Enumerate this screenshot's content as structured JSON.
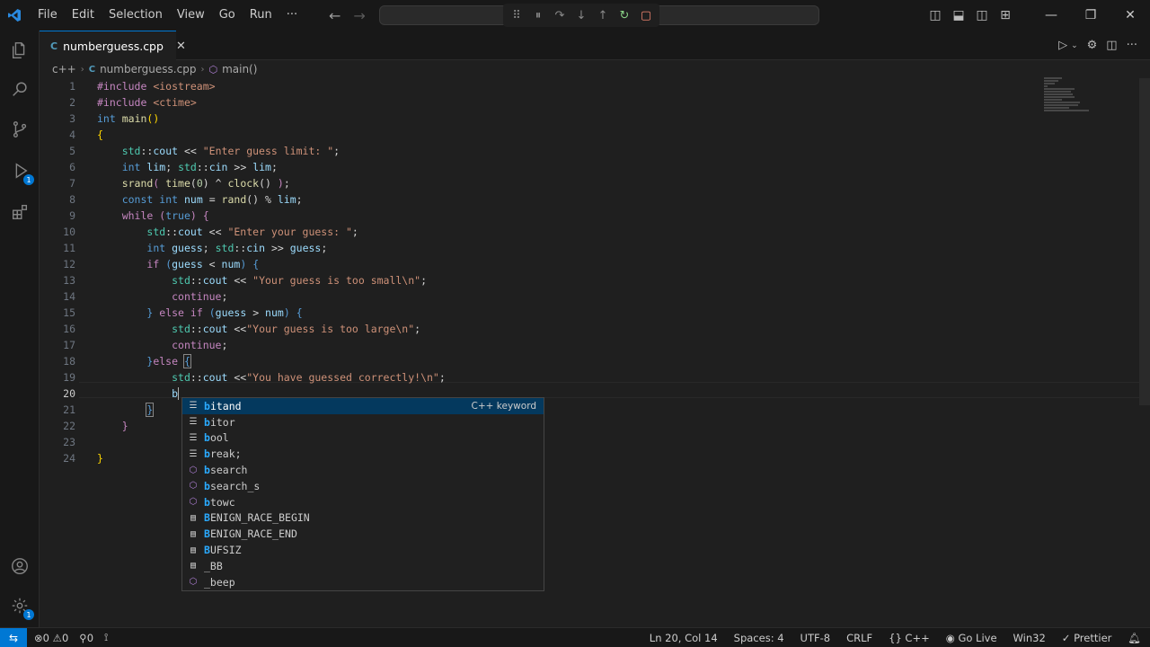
{
  "menu": [
    "File",
    "Edit",
    "Selection",
    "View",
    "Go",
    "Run",
    "···"
  ],
  "tab": {
    "label": "numberguess.cpp",
    "icon": "C"
  },
  "breadcrumb": {
    "lang": "c++",
    "file": "numberguess.cpp",
    "symbol": "main()"
  },
  "active_line": "20",
  "lines": [
    {
      "n": "1"
    },
    {
      "n": "2"
    },
    {
      "n": "3"
    },
    {
      "n": "4"
    },
    {
      "n": "5"
    },
    {
      "n": "6"
    },
    {
      "n": "7"
    },
    {
      "n": "8"
    },
    {
      "n": "9"
    },
    {
      "n": "10"
    },
    {
      "n": "11"
    },
    {
      "n": "12"
    },
    {
      "n": "13"
    },
    {
      "n": "14"
    },
    {
      "n": "15"
    },
    {
      "n": "16"
    },
    {
      "n": "17"
    },
    {
      "n": "18"
    },
    {
      "n": "19"
    },
    {
      "n": "20"
    },
    {
      "n": "21"
    },
    {
      "n": "22"
    },
    {
      "n": "23"
    },
    {
      "n": "24"
    }
  ],
  "suggestions": [
    {
      "label": "bitand",
      "match": "b",
      "rest": "itand",
      "icon": "keyword",
      "detail": "C++ keyword",
      "selected": true
    },
    {
      "label": "bitor",
      "match": "b",
      "rest": "itor",
      "icon": "keyword"
    },
    {
      "label": "bool",
      "match": "b",
      "rest": "ool",
      "icon": "keyword"
    },
    {
      "label": "break;",
      "match": "b",
      "rest": "reak;",
      "icon": "keyword"
    },
    {
      "label": "bsearch",
      "match": "b",
      "rest": "search",
      "icon": "method"
    },
    {
      "label": "bsearch_s",
      "match": "b",
      "rest": "search_s",
      "icon": "method"
    },
    {
      "label": "btowc",
      "match": "b",
      "rest": "towc",
      "icon": "method"
    },
    {
      "label": "BENIGN_RACE_BEGIN",
      "match": "B",
      "rest": "ENIGN_RACE_BEGIN",
      "icon": "constant"
    },
    {
      "label": "BENIGN_RACE_END",
      "match": "B",
      "rest": "ENIGN_RACE_END",
      "icon": "constant"
    },
    {
      "label": "BUFSIZ",
      "match": "B",
      "rest": "UFSIZ",
      "icon": "constant"
    },
    {
      "label": "_BB",
      "match": "",
      "rest": "_BB",
      "icon": "constant"
    },
    {
      "label": "_beep",
      "match": "",
      "rest": "_beep",
      "icon": "method"
    }
  ],
  "status": {
    "errors": "0",
    "warnings": "0",
    "ports": "0",
    "position": "Ln 20, Col 14",
    "spaces": "Spaces: 4",
    "encoding": "UTF-8",
    "eol": "CRLF",
    "language": "C++",
    "golive": "Go Live",
    "platform": "Win32",
    "formatter": "Prettier"
  },
  "colors": {
    "accent": "#0078d4",
    "editor_bg": "#1f1f1f",
    "chrome_bg": "#181818"
  },
  "icons": [
    "vscode-logo-icon",
    "explorer-icon",
    "search-icon",
    "source-control-icon",
    "run-debug-icon",
    "extensions-icon",
    "account-icon",
    "settings-gear-icon",
    "close-icon",
    "run-icon",
    "split-editor-icon",
    "bell-icon"
  ]
}
